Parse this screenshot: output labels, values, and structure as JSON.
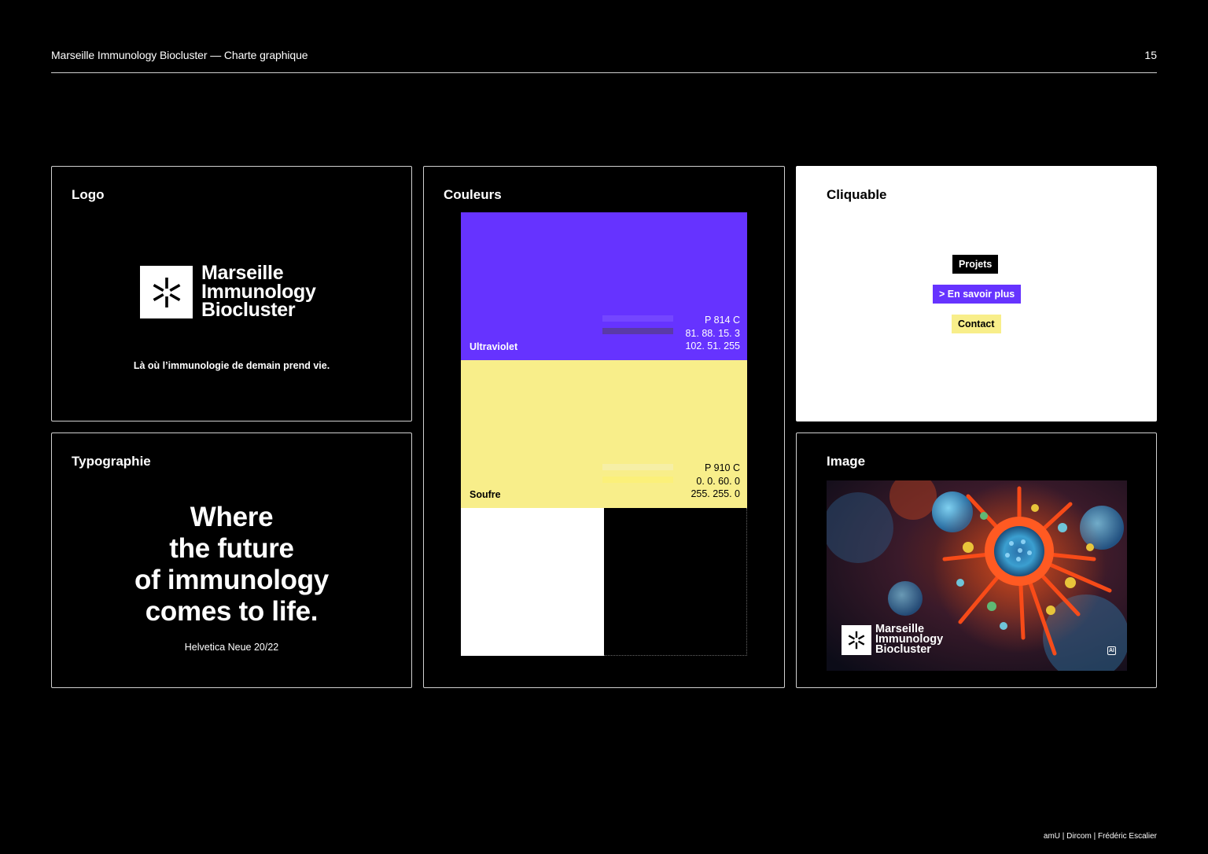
{
  "header": {
    "title": "Marseille Immunology Biocluster — Charte graphique",
    "page_number": "15"
  },
  "footer": {
    "credit": "amU | Dircom | Frédéric Escalier"
  },
  "logo_panel": {
    "title": "Logo",
    "logo_lines": [
      "Marseille",
      "Immunology",
      "Biocluster"
    ],
    "tagline": "Là où l’immunologie de demain prend vie."
  },
  "typography_panel": {
    "title": "Typographie",
    "sample_lines": [
      "Where",
      "the future",
      "of immunology",
      "comes to life."
    ],
    "spec": "Helvetica Neue 20/22"
  },
  "colors_panel": {
    "title": "Couleurs",
    "swatches": [
      {
        "name": "Ultraviolet",
        "pantone": "P 814 C",
        "cmyk": "81. 88. 15. 3",
        "rgb": "102. 51. 255",
        "hex": "#6633FF"
      },
      {
        "name": "Soufre",
        "pantone": "P 910 C",
        "cmyk": "0. 0. 60. 0",
        "rgb": "255. 255. 0",
        "hex": "#F8EE8A"
      }
    ],
    "neutrals": {
      "white": "#FFFFFF",
      "black": "#000000"
    }
  },
  "clickable_panel": {
    "title": "Cliquable",
    "buttons": {
      "projets": "Projets",
      "savoir": "> En savoir plus",
      "contact": "Contact"
    }
  },
  "image_panel": {
    "title": "Image",
    "logo_lines": [
      "Marseille",
      "Immunology",
      "Biocluster"
    ],
    "badge": "AI"
  },
  "icons": {
    "logo_mark": "asterisk-logo-icon"
  }
}
